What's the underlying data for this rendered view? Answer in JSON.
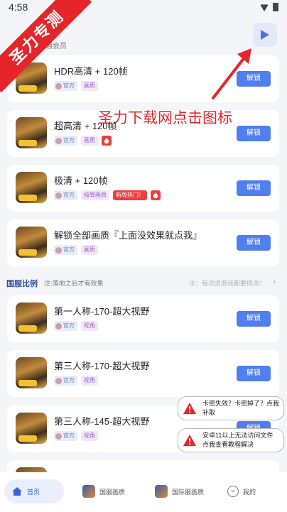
{
  "status": {
    "time": "4:58"
  },
  "watermark": {
    "ribbon": "圣力专测",
    "overlay": "圣力下载网点击图标"
  },
  "header": {
    "title": "助手",
    "subtitle": "普通会员"
  },
  "cards_top": [
    {
      "name": "HDR高清 + 120帧",
      "tags": [
        "官方",
        "画质"
      ],
      "fire": false,
      "button": "解锁"
    },
    {
      "name": "超高清 + 120帧",
      "tags": [
        "官方",
        "画质"
      ],
      "fire": true,
      "button": "解锁"
    },
    {
      "name": "极清 + 120帧",
      "tags": [
        "官方",
        "极致画质",
        "新版热门！"
      ],
      "fire": true,
      "button": "解锁"
    },
    {
      "name": "解锁全部画质『上面没效果就点我』",
      "tags": [
        "官方",
        "画质"
      ],
      "fire": false,
      "button": "解锁"
    }
  ],
  "section": {
    "title": "国服比例",
    "note": "注:落地之后才有效果",
    "hint": "注：每次进游戏都要修改！"
  },
  "cards_bottom": [
    {
      "name": "第一人称-170-超大视野",
      "tags": [
        "官方",
        "视角"
      ],
      "button": "解锁"
    },
    {
      "name": "第三人称-170-超大视野",
      "tags": [
        "官方",
        "视角"
      ],
      "button": "解锁"
    },
    {
      "name": "第三人称-145-超大视野",
      "tags": [
        "官方",
        "视角"
      ],
      "button": "解锁"
    }
  ],
  "toasts": [
    "卡密失效？卡密掉了？点我补取",
    "安卓11以上无法访问文件点我查看教程解决"
  ],
  "tabs": [
    {
      "label": "首页"
    },
    {
      "label": "国服画质"
    },
    {
      "label": "国际服画质"
    },
    {
      "label": "我的"
    }
  ],
  "colors": {
    "accent": "#4f7fef",
    "warning": "#e5252a"
  }
}
